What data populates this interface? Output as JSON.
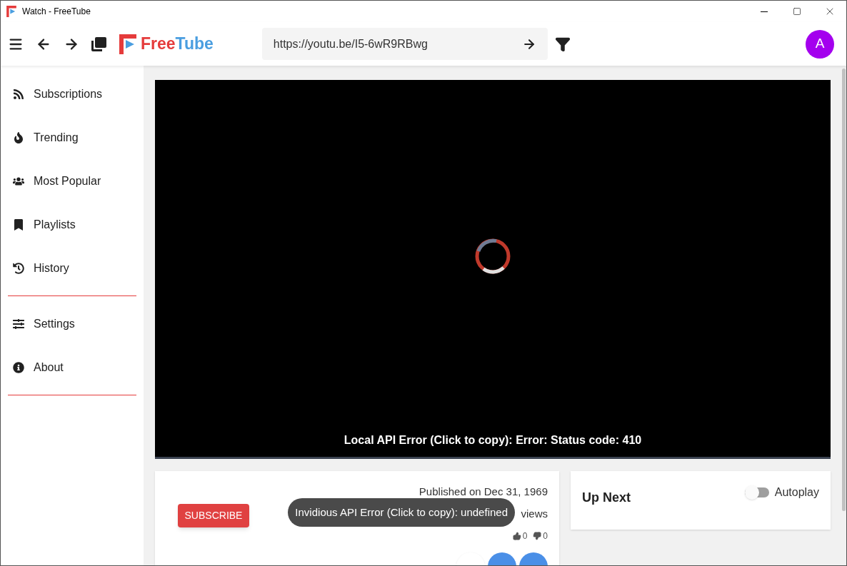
{
  "window": {
    "title": "Watch - FreeTube"
  },
  "topbar": {
    "logo": {
      "part_1": "Free",
      "part_2": "Tube"
    },
    "search": {
      "value": "https://youtu.be/I5-6wR9RBwg"
    },
    "avatar": "A"
  },
  "sidebar": {
    "items": [
      {
        "label": "Subscriptions"
      },
      {
        "label": "Trending"
      },
      {
        "label": "Most Popular"
      },
      {
        "label": "Playlists"
      },
      {
        "label": "History"
      }
    ],
    "bottom_items": [
      {
        "label": "Settings"
      },
      {
        "label": "About"
      }
    ]
  },
  "player": {
    "error": "Local API Error (Click to copy): Error: Status code: 410"
  },
  "video_info": {
    "subscribe": "SUBSCRIBE",
    "published": "Published on Dec 31, 1969",
    "views": "views",
    "likes": "0",
    "dislikes": "0"
  },
  "toast": {
    "text": "Invidious API Error (Click to copy): undefined"
  },
  "up_next": {
    "title": "Up Next",
    "autoplay": {
      "label": "Autoplay",
      "on": false
    }
  }
}
